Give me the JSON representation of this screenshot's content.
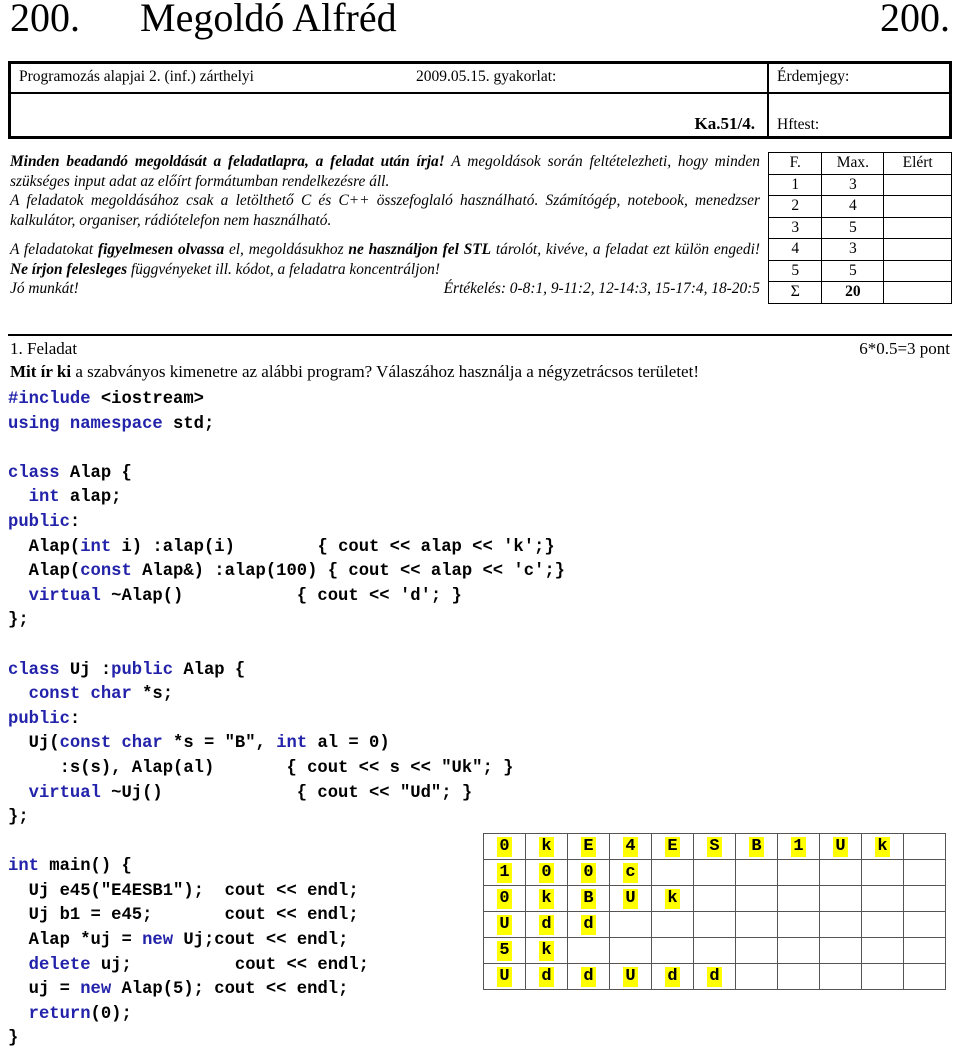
{
  "title": {
    "left_number": "200.",
    "name": "Megoldó Alfréd",
    "right_number": "200."
  },
  "header": {
    "course": "Programozás alapjai 2. (inf.) zárthelyi",
    "date_label": "2009.05.15. gyakorlat:",
    "grade_label": "Érdemjegy:",
    "code": "Ka.51/4.",
    "hftest_label": "Hftest:"
  },
  "instructions": {
    "line1_bold": "Minden beadandó megoldását a feladatlapra, a feladat után írja!",
    "line1_rest": " A megoldások során feltételezheti, hogy minden szükséges input adat az előírt formátumban rendelkezésre áll.",
    "line2": "A feladatok megoldásához csak a letölthető C és C++ összefoglaló használható. Számítógép, notebook, menedzser kalkulátor, organiser, rádiótelefon nem használható.",
    "para2_a": "A feladatokat ",
    "para2_b_bold": "figyelmesen olvassa",
    "para2_c": " el, megoldásukhoz ",
    "para2_d_bold": "ne használjon fel STL",
    "para2_e": " tárolót, kivéve, a feladat ezt külön engedi! ",
    "para2_f_bold": "Ne írjon felesleges",
    "para2_g": " függvényeket ill. kódot, a feladatra koncentráljon!",
    "good_work": "Jó munkát!",
    "evaluation": "Értékelés: 0-8:1, 9-11:2, 12-14:3, 15-17:4, 18-20:5"
  },
  "grade_table": {
    "headers": [
      "F.",
      "Max.",
      "Elért"
    ],
    "rows": [
      {
        "f": "1",
        "max": "3",
        "elert": ""
      },
      {
        "f": "2",
        "max": "4",
        "elert": ""
      },
      {
        "f": "3",
        "max": "5",
        "elert": ""
      },
      {
        "f": "4",
        "max": "3",
        "elert": ""
      },
      {
        "f": "5",
        "max": "5",
        "elert": ""
      }
    ],
    "sum": {
      "symbol": "Σ",
      "max": "20",
      "elert": ""
    }
  },
  "task": {
    "heading": "1. Feladat",
    "points": "6*0.5=3 pont",
    "question_bold": "Mit ír ki",
    "question_rest": " a szabványos kimenetre az alábbi program? Válaszához használja a négyzetrácsos területet!"
  },
  "code": {
    "lines": [
      [
        {
          "t": "#include",
          "c": "kw"
        },
        {
          "t": " <iostream>",
          "c": ""
        }
      ],
      [
        {
          "t": "using namespace",
          "c": "kw"
        },
        {
          "t": " std;",
          "c": ""
        }
      ],
      [],
      [
        {
          "t": "class",
          "c": "kw"
        },
        {
          "t": " Alap {",
          "c": ""
        }
      ],
      [
        {
          "t": "  int",
          "c": "kw"
        },
        {
          "t": " alap;",
          "c": ""
        }
      ],
      [
        {
          "t": "public",
          "c": "kw"
        },
        {
          "t": ":",
          "c": ""
        }
      ],
      [
        {
          "t": "  Alap(",
          "c": ""
        },
        {
          "t": "int",
          "c": "kw"
        },
        {
          "t": " i) :alap(i)        { cout << alap << 'k';}",
          "c": ""
        }
      ],
      [
        {
          "t": "  Alap(",
          "c": ""
        },
        {
          "t": "const",
          "c": "kw"
        },
        {
          "t": " Alap&) :alap(100) { cout << alap << 'c';}",
          "c": ""
        }
      ],
      [
        {
          "t": "  virtual",
          "c": "kw"
        },
        {
          "t": " ~Alap()           { cout << 'd'; }",
          "c": ""
        }
      ],
      [
        {
          "t": "};",
          "c": ""
        }
      ],
      [],
      [
        {
          "t": "class",
          "c": "kw"
        },
        {
          "t": " Uj :",
          "c": ""
        },
        {
          "t": "public",
          "c": "kw"
        },
        {
          "t": " Alap {",
          "c": ""
        }
      ],
      [
        {
          "t": "  const char",
          "c": "kw"
        },
        {
          "t": " *s;",
          "c": ""
        }
      ],
      [
        {
          "t": "public",
          "c": "kw"
        },
        {
          "t": ":",
          "c": ""
        }
      ],
      [
        {
          "t": "  Uj(",
          "c": ""
        },
        {
          "t": "const char",
          "c": "kw"
        },
        {
          "t": " *s = \"B\", ",
          "c": ""
        },
        {
          "t": "int",
          "c": "kw"
        },
        {
          "t": " al = 0)",
          "c": ""
        }
      ],
      [
        {
          "t": "     :s(s), Alap(al)       { cout << s << \"Uk\"; }",
          "c": ""
        }
      ],
      [
        {
          "t": "  virtual",
          "c": "kw"
        },
        {
          "t": " ~Uj()             { cout << \"Ud\"; }",
          "c": ""
        }
      ],
      [
        {
          "t": "};",
          "c": ""
        }
      ],
      [],
      [
        {
          "t": "int",
          "c": "kw"
        },
        {
          "t": " main() {",
          "c": ""
        }
      ],
      [
        {
          "t": "  Uj e45(\"E4ESB1\");  cout << endl;",
          "c": ""
        }
      ],
      [
        {
          "t": "  Uj b1 = e45;       cout << endl;",
          "c": ""
        }
      ],
      [
        {
          "t": "  Alap *uj = ",
          "c": ""
        },
        {
          "t": "new",
          "c": "kw"
        },
        {
          "t": " Uj;cout << endl;",
          "c": ""
        }
      ],
      [
        {
          "t": "  delete",
          "c": "kw"
        },
        {
          "t": " uj;          cout << endl;",
          "c": ""
        }
      ],
      [
        {
          "t": "  uj = ",
          "c": ""
        },
        {
          "t": "new",
          "c": "kw"
        },
        {
          "t": " Alap(5); cout << endl;",
          "c": ""
        }
      ],
      [
        {
          "t": "  return",
          "c": "kw"
        },
        {
          "t": "(0);",
          "c": ""
        }
      ],
      [
        {
          "t": "}",
          "c": ""
        }
      ]
    ]
  },
  "answer_grid": {
    "columns": 11,
    "rows": [
      [
        "0",
        "k",
        "E",
        "4",
        "E",
        "S",
        "B",
        "1",
        "U",
        "k",
        ""
      ],
      [
        "1",
        "0",
        "0",
        "c",
        "",
        "",
        "",
        "",
        "",
        "",
        ""
      ],
      [
        "0",
        "k",
        "B",
        "U",
        "k",
        "",
        "",
        "",
        "",
        "",
        ""
      ],
      [
        "U",
        "d",
        "d",
        "",
        "",
        "",
        "",
        "",
        "",
        "",
        ""
      ],
      [
        "5",
        "k",
        "",
        "",
        "",
        "",
        "",
        "",
        "",
        "",
        ""
      ],
      [
        "U",
        "d",
        "d",
        "U",
        "d",
        "d",
        "",
        "",
        "",
        "",
        ""
      ]
    ],
    "highlight_color": "#ffff00"
  }
}
